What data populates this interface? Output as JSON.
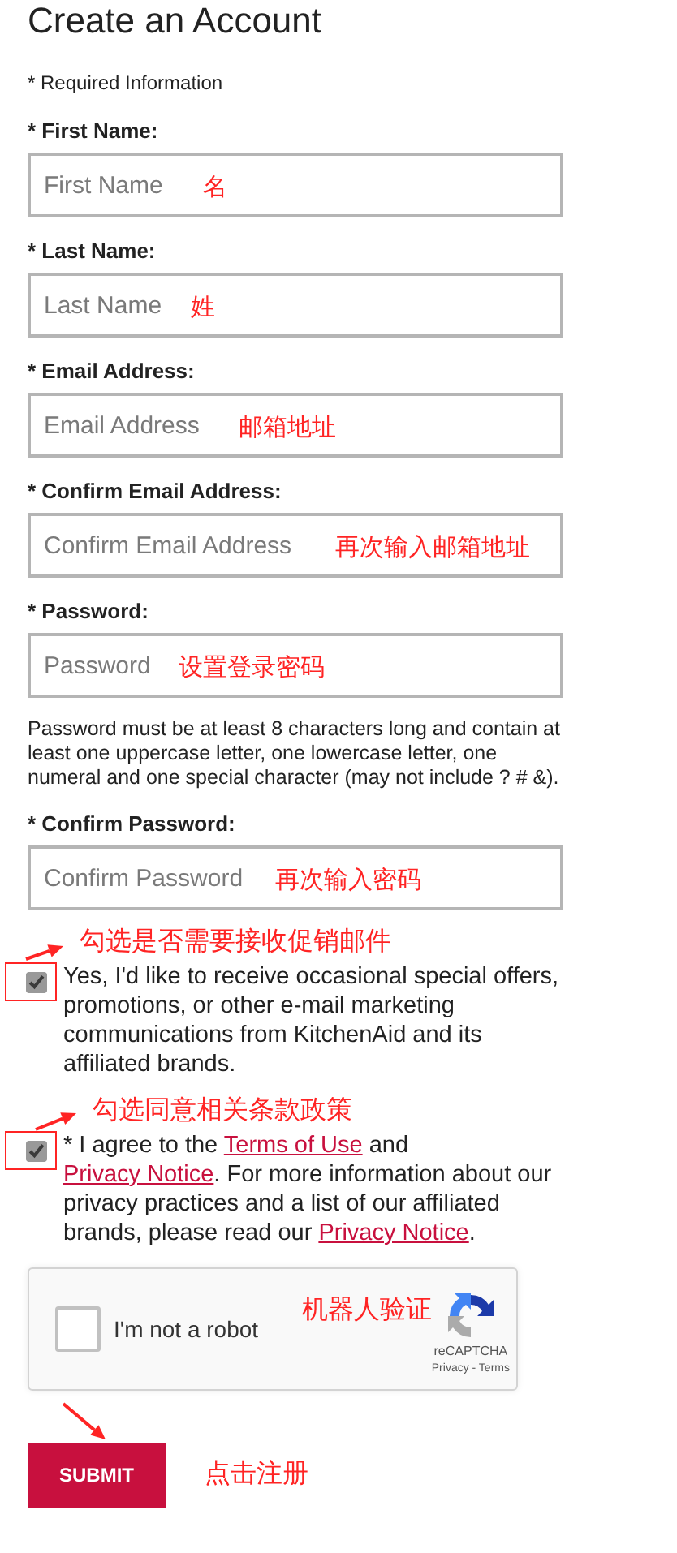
{
  "title": "Create an Account",
  "required_note": "* Required Information",
  "fields": [
    {
      "label": "* First Name:",
      "placeholder": "First Name",
      "annotation": "名"
    },
    {
      "label": "* Last Name:",
      "placeholder": "Last Name",
      "annotation": "姓"
    },
    {
      "label": "* Email Address:",
      "placeholder": "Email Address",
      "annotation": "邮箱地址"
    },
    {
      "label": "* Confirm Email Address:",
      "placeholder": "Confirm Email Address",
      "annotation": "再次输入邮箱地址"
    },
    {
      "label": "* Password:",
      "placeholder": "Password",
      "annotation": "设置登录密码",
      "hint": "Password must be at least 8 characters long and contain at least one uppercase letter, one lowercase letter, one numeral and one special character (may not include ? # &)."
    },
    {
      "label": "* Confirm Password:",
      "placeholder": "Confirm Password",
      "annotation": "再次输入密码"
    }
  ],
  "checkboxes": [
    {
      "checked": true,
      "annotation": "勾选是否需要接收促销邮件",
      "segments": [
        {
          "kind": "text",
          "text": "Yes, I'd like to receive occasional special offers, promotions, or other e-mail marketing communications from KitchenAid and its affiliated brands."
        }
      ]
    },
    {
      "checked": true,
      "annotation": "勾选同意相关条款政策",
      "segments": [
        {
          "kind": "text",
          "text": "* I agree to the "
        },
        {
          "kind": "link",
          "text": "Terms of Use"
        },
        {
          "kind": "text",
          "text": " and "
        },
        {
          "kind": "link",
          "text": "Privacy Notice"
        },
        {
          "kind": "text",
          "text": ". For more information about our privacy practices and a list of our affiliated brands, please read our "
        },
        {
          "kind": "link",
          "text": "Privacy Notice"
        },
        {
          "kind": "text",
          "text": "."
        }
      ]
    }
  ],
  "recaptcha": {
    "checked": false,
    "label": "I'm not a robot",
    "annotation": "机器人验证",
    "brand": "reCAPTCHA",
    "links": "Privacy - Terms"
  },
  "submit": {
    "label": "SUBMIT",
    "annotation": "点击注册"
  }
}
